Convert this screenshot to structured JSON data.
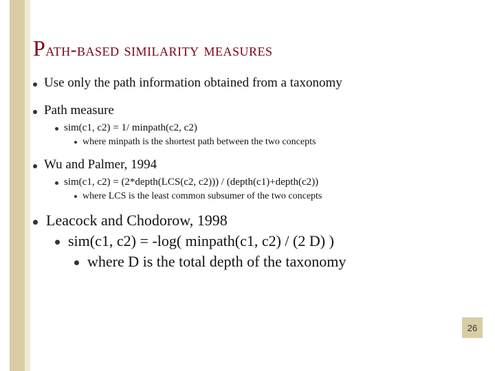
{
  "title_main": "Path-based similarity measures",
  "bullet1": "Use only the path information obtained from a taxonomy",
  "bullet2": "Path measure",
  "bullet2_1": "sim(c1, c2) = 1/ minpath(c2, c2)",
  "bullet2_1_1": "where minpath is the shortest path between the two concepts",
  "bullet3": "Wu and Palmer, 1994",
  "bullet3_1": "sim(c1, c2) = (2*depth(LCS(c2, c2))) / (depth(c1)+depth(c2))",
  "bullet3_1_1": "where LCS is the least common subsumer of the two concepts",
  "bullet4": "Leacock and Chodorow, 1998",
  "bullet4_1": "sim(c1, c2) = -log( minpath(c1, c2) / (2 D) )",
  "bullet4_1_1": "where D is the total depth of the taxonomy",
  "page_number": "26"
}
